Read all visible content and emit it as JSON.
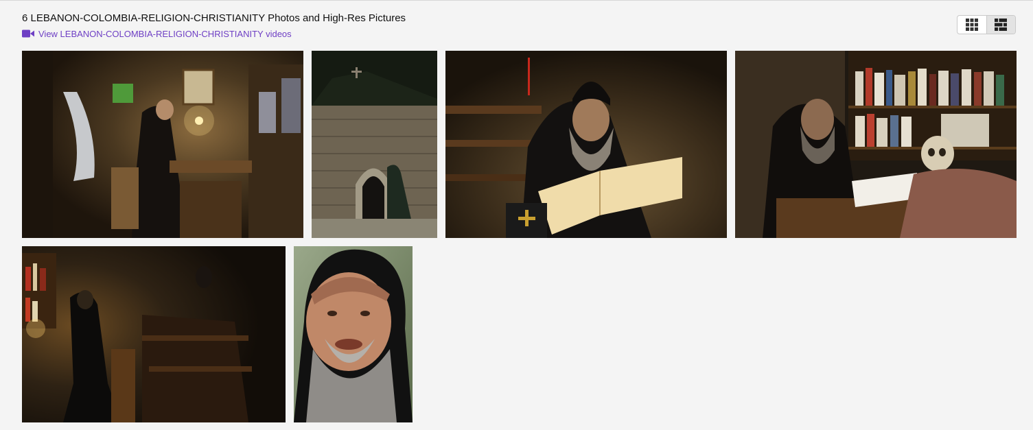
{
  "header": {
    "title": "6 LEBANON-COLOMBIA-RELIGION-CHRISTIANITY Photos and High-Res Pictures",
    "videos_link": "View LEBANON-COLOMBIA-RELIGION-CHRISTIANITY videos",
    "video_icon": "video-camera-icon",
    "link_color": "#6e3fc4"
  },
  "view_toggle": {
    "options": [
      "grid-view",
      "mosaic-view"
    ],
    "selected": "mosaic-view"
  },
  "photos": [
    {
      "subject": "monk in cluttered stone cell"
    },
    {
      "subject": "stone hermitage with arched doorway"
    },
    {
      "subject": "monk reading large book"
    },
    {
      "subject": "monk writing at desk with skull"
    },
    {
      "subject": "monk kneeling in prayer"
    },
    {
      "subject": "portrait of bearded monk"
    }
  ]
}
